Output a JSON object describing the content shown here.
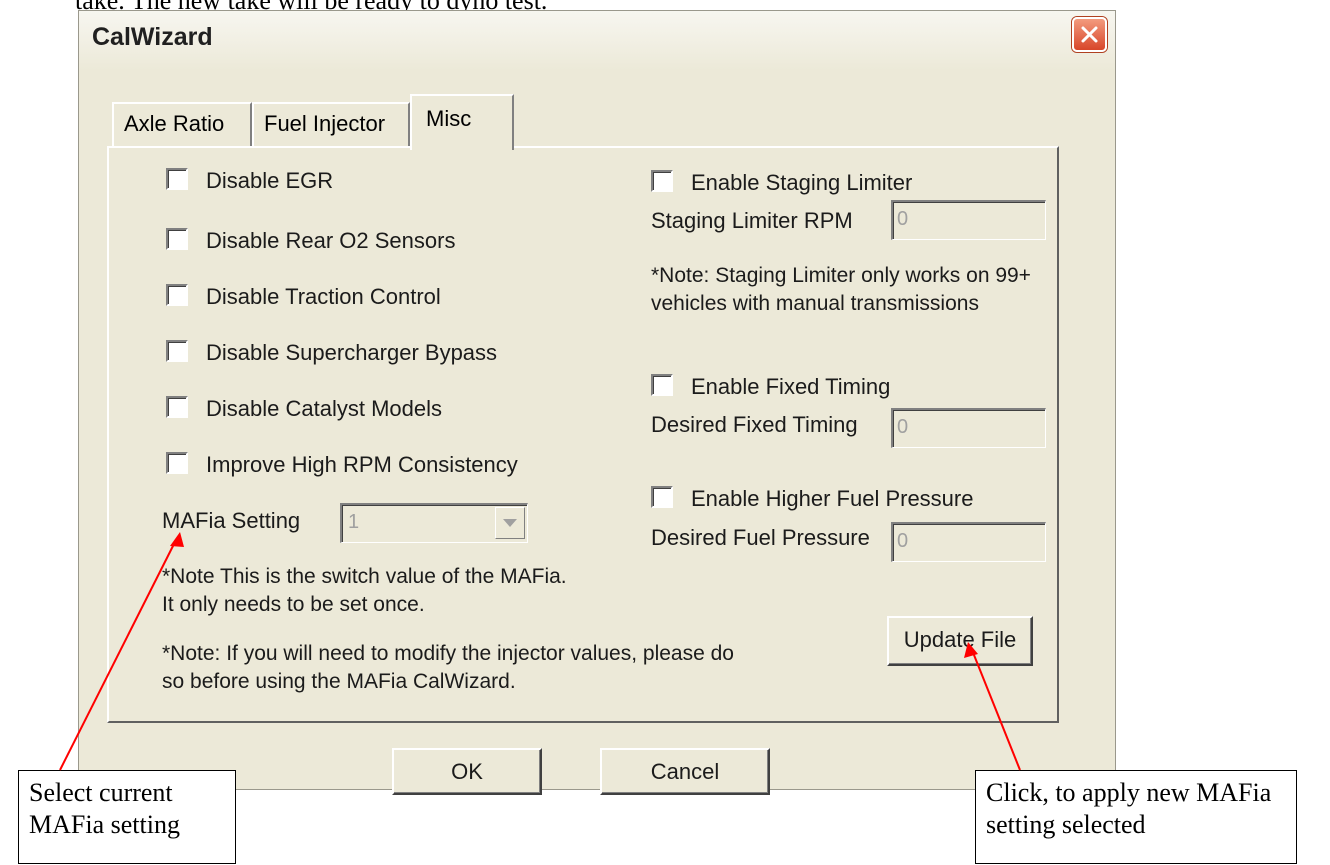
{
  "document": {
    "top_line": "take. The new take will be ready to dyno test."
  },
  "dialog": {
    "title": "CalWizard",
    "tabs": [
      "Axle Ratio",
      "Fuel Injector",
      "Misc"
    ],
    "checkboxes_left": [
      "Disable EGR",
      "Disable Rear O2 Sensors",
      "Disable Traction Control",
      "Disable Supercharger Bypass",
      "Disable Catalyst Models",
      "Improve High RPM Consistency"
    ],
    "mafia": {
      "label": "MAFia Setting",
      "value": "1",
      "note": "*Note This is the switch value of the MAFia. It only needs to be set once.",
      "note2": "*Note: If you will need to modify the injector values, please do so before using the MAFia CalWizard."
    },
    "staging": {
      "checkbox": "Enable Staging Limiter",
      "label": "Staging Limiter RPM",
      "value": "0",
      "note": "*Note: Staging Limiter only works on 99+ vehicles with manual transmissions"
    },
    "timing": {
      "checkbox": "Enable Fixed Timing",
      "label": "Desired Fixed Timing",
      "value": "0"
    },
    "fuel": {
      "checkbox": "Enable Higher Fuel Pressure",
      "label": "Desired Fuel Pressure",
      "value": "0"
    },
    "update_button": "Update File",
    "ok_button": "OK",
    "cancel_button": "Cancel"
  },
  "callouts": {
    "left": "Select current MAFia setting",
    "right": "Click, to apply new MAFia setting selected"
  },
  "colors": {
    "dialog_bg": "#ece9d8",
    "close_red": "#d8462a",
    "arrow_red": "#ff0000"
  }
}
